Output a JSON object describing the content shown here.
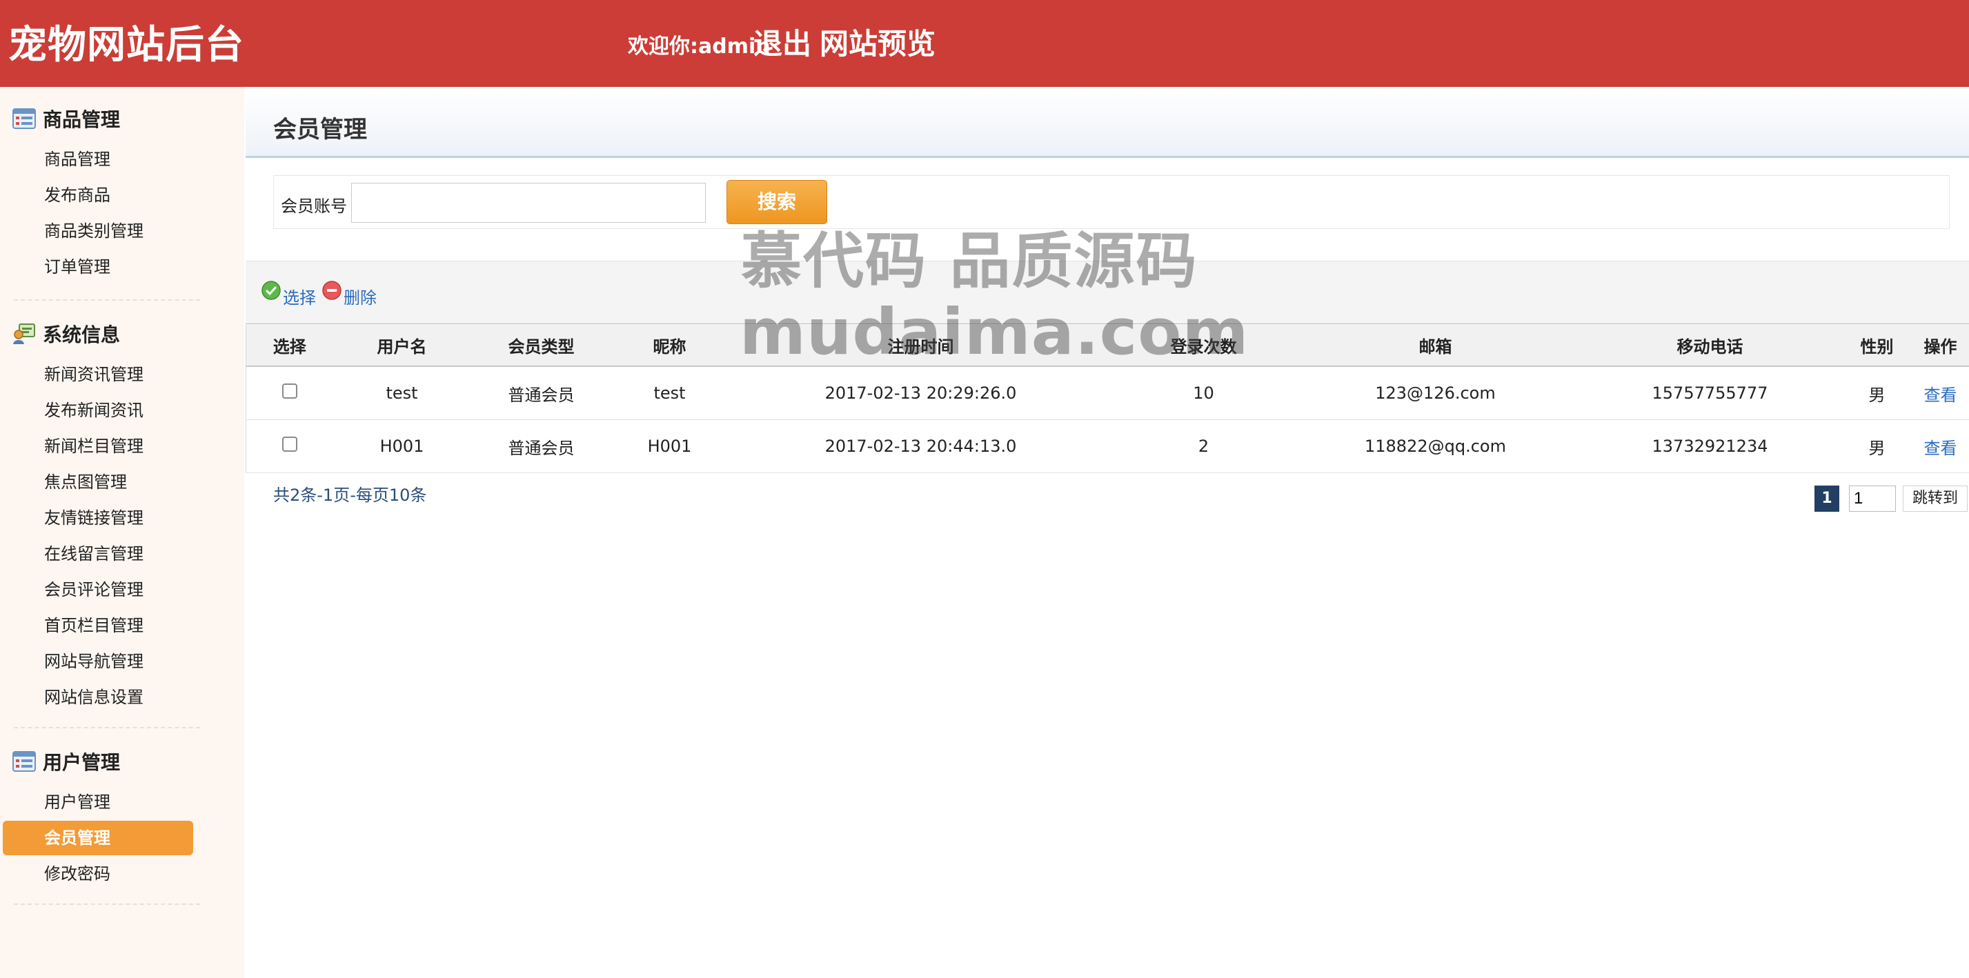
{
  "header": {
    "site_title": "宠物网站后台",
    "welcome": "欢迎你:admin",
    "logout": "退出",
    "preview": "网站预览",
    "bg_color": "#cb3d36"
  },
  "sidebar": {
    "groups": [
      {
        "title": "商品管理",
        "icon": "list-icon",
        "items": [
          "商品管理",
          "发布商品",
          "商品类别管理",
          "订单管理"
        ]
      },
      {
        "title": "系统信息",
        "icon": "system-info-icon",
        "items": [
          "新闻资讯管理",
          "发布新闻资讯",
          "新闻栏目管理",
          "焦点图管理",
          "友情链接管理",
          "在线留言管理",
          "会员评论管理",
          "首页栏目管理",
          "网站导航管理",
          "网站信息设置"
        ]
      },
      {
        "title": "用户管理",
        "icon": "list-icon",
        "items": [
          "用户管理",
          "会员管理",
          "修改密码"
        ]
      }
    ],
    "active_item": "会员管理",
    "active_color": "#f39b36"
  },
  "main": {
    "title": "会员管理",
    "search": {
      "label": "会员账号",
      "value": "",
      "button": "搜索"
    },
    "toolbar": {
      "select": "选择",
      "delete": "删除"
    },
    "table": {
      "headers": [
        "选择",
        "用户名",
        "会员类型",
        "昵称",
        "注册时间",
        "登录次数",
        "邮箱",
        "移动电话",
        "性别",
        "操作"
      ],
      "rows": [
        {
          "checked": false,
          "username": "test",
          "type": "普通会员",
          "nickname": "test",
          "registered": "2017-02-13 20:29:26.0",
          "logins": "10",
          "email": "123@126.com",
          "phone": "15757755777",
          "gender": "男",
          "action": "查看"
        },
        {
          "checked": false,
          "username": "H001",
          "type": "普通会员",
          "nickname": "H001",
          "registered": "2017-02-13 20:44:13.0",
          "logins": "2",
          "email": "118822@qq.com",
          "phone": "13732921234",
          "gender": "男",
          "action": "查看"
        }
      ]
    },
    "summary": "共2条-1页-每页10条",
    "pager": {
      "current_page": "1",
      "jump_value": "1",
      "jump_label": "跳转到"
    }
  },
  "watermark": {
    "line1": "慕代码 品质源码",
    "line2": "mudaima.com"
  }
}
